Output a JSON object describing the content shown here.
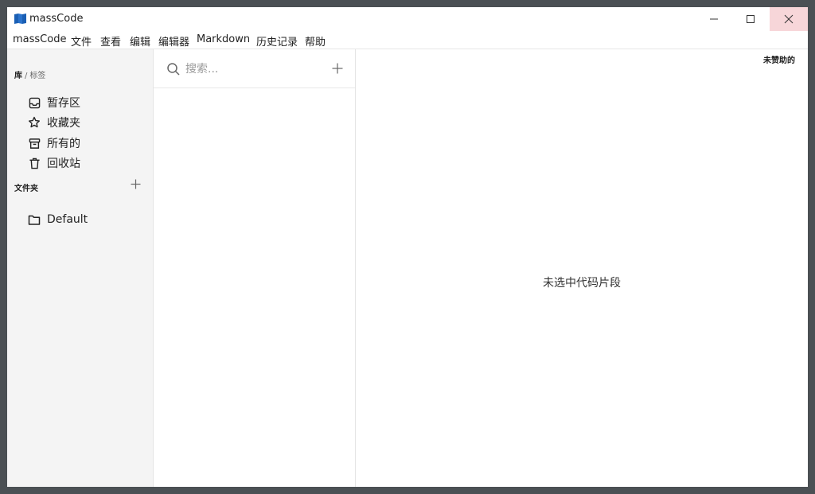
{
  "app": {
    "title": "massCode",
    "brand_color": "#1a5fb4"
  },
  "window_controls": {
    "minimize": "minimize-icon",
    "maximize": "maximize-icon",
    "close": "close-icon"
  },
  "menu": {
    "items": [
      {
        "label": "massCode"
      },
      {
        "label": "文件"
      },
      {
        "label": "查看"
      },
      {
        "label": "编辑"
      },
      {
        "label": "编辑器"
      },
      {
        "label": "Markdown"
      },
      {
        "label": "历史记录"
      },
      {
        "label": "帮助"
      }
    ]
  },
  "sidebar": {
    "breadcrumb": {
      "library": "库",
      "separator": "/",
      "tags": "标签"
    },
    "library_items": [
      {
        "label": "暂存区",
        "icon": "inbox-icon"
      },
      {
        "label": "收藏夹",
        "icon": "star-icon"
      },
      {
        "label": "所有的",
        "icon": "archive-icon"
      },
      {
        "label": "回收站",
        "icon": "trash-icon"
      }
    ],
    "folders_header": "文件夹",
    "folders": [
      {
        "label": "Default",
        "icon": "folder-icon"
      }
    ]
  },
  "snippets": {
    "search_placeholder": "搜索..."
  },
  "editor": {
    "sponsor": "未赞助的",
    "empty_message": "未选中代码片段"
  }
}
